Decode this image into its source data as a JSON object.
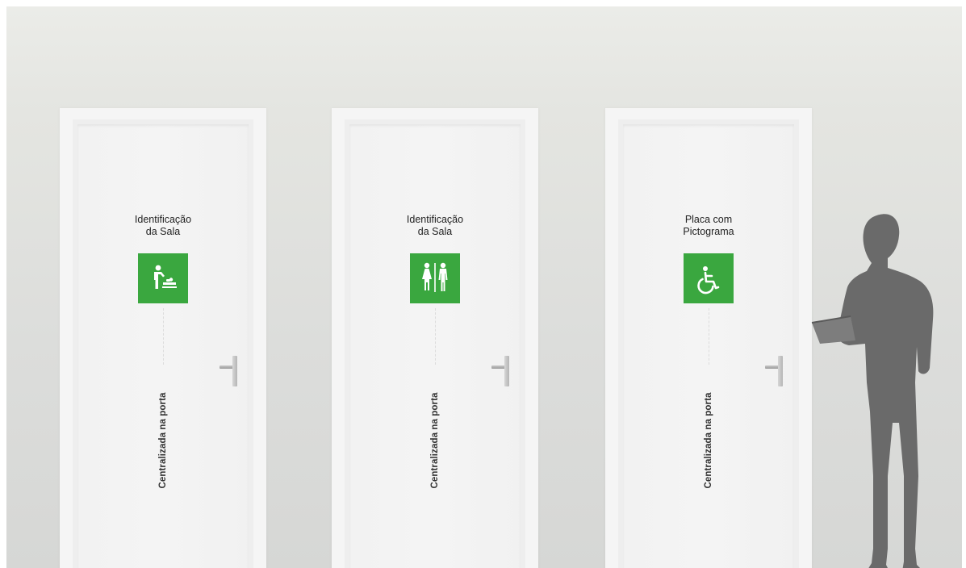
{
  "doors": [
    {
      "title_lines": [
        "Identificação",
        "da Sala"
      ],
      "pictogram": "baby-changing-icon",
      "vertical_label": "Centralizada na porta"
    },
    {
      "title_lines": [
        "Identificação",
        "da Sala"
      ],
      "pictogram": "restroom-icon",
      "vertical_label": "Centralizada na porta"
    },
    {
      "title_lines": [
        "Placa com",
        "Pictograma"
      ],
      "pictogram": "accessibility-icon",
      "vertical_label": "Centralizada na porta"
    }
  ],
  "colors": {
    "sign_green": "#3aa73f",
    "wall": "#e3e4e0",
    "door": "#f3f3f3",
    "silhouette": "#6a6a6a"
  }
}
